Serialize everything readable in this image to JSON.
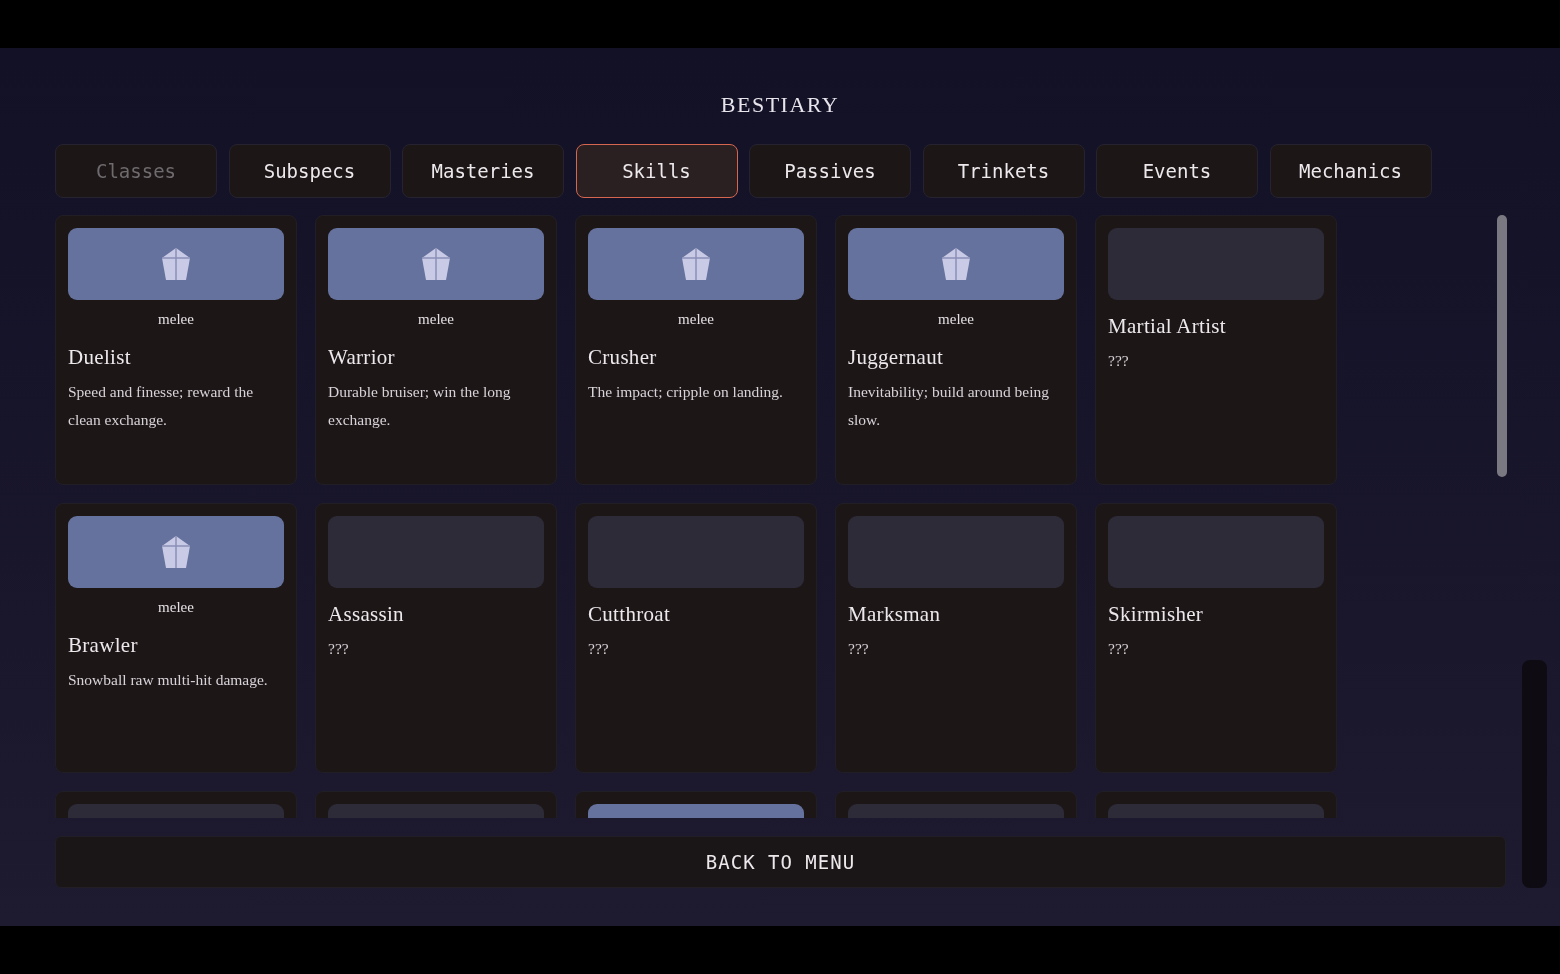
{
  "title": "BESTIARY",
  "tabs": [
    {
      "label": "Classes",
      "selected": false,
      "disabled": true
    },
    {
      "label": "Subspecs",
      "selected": false,
      "disabled": false
    },
    {
      "label": "Masteries",
      "selected": false,
      "disabled": false
    },
    {
      "label": "Skills",
      "selected": true,
      "disabled": false
    },
    {
      "label": "Passives",
      "selected": false,
      "disabled": false
    },
    {
      "label": "Trinkets",
      "selected": false,
      "disabled": false
    },
    {
      "label": "Events",
      "selected": false,
      "disabled": false
    },
    {
      "label": "Mechanics",
      "selected": false,
      "disabled": false
    }
  ],
  "cards": [
    {
      "unlocked": true,
      "tag": "melee",
      "name": "Duelist",
      "description": "Speed and finesse; reward the clean exchange."
    },
    {
      "unlocked": true,
      "tag": "melee",
      "name": "Warrior",
      "description": "Durable bruiser; win the long exchange."
    },
    {
      "unlocked": true,
      "tag": "melee",
      "name": "Crusher",
      "description": "The impact; cripple on landing."
    },
    {
      "unlocked": true,
      "tag": "melee",
      "name": "Juggernaut",
      "description": "Inevitability; build around being slow."
    },
    {
      "unlocked": false,
      "name": "Martial Artist",
      "description": "???"
    },
    {
      "unlocked": true,
      "tag": "melee",
      "name": "Brawler",
      "description": "Snowball raw multi-hit damage."
    },
    {
      "unlocked": false,
      "name": "Assassin",
      "description": "???"
    },
    {
      "unlocked": false,
      "name": "Cutthroat",
      "description": "???"
    },
    {
      "unlocked": false,
      "name": "Marksman",
      "description": "???"
    },
    {
      "unlocked": false,
      "name": "Skirmisher",
      "description": "???"
    },
    {
      "unlocked": false
    },
    {
      "unlocked": false
    },
    {
      "unlocked": true
    },
    {
      "unlocked": false
    },
    {
      "unlocked": false
    }
  ],
  "back_button": "BACK TO MENU"
}
